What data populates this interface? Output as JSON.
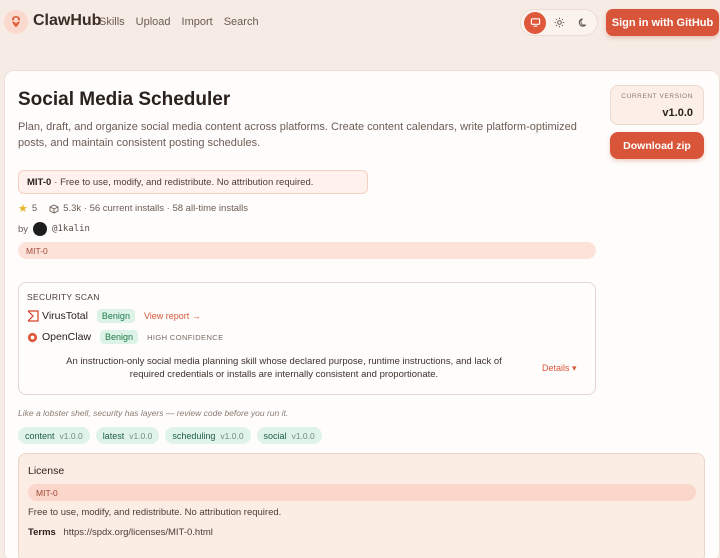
{
  "header": {
    "brand": "ClawHub",
    "nav": [
      "Skills",
      "Upload",
      "Import",
      "Search"
    ],
    "signin_label": "Sign in  with GitHub"
  },
  "skill": {
    "title": "Social Media Scheduler",
    "description": "Plan, draft, and organize social media content across platforms. Create content calendars, write platform-optimized posts, and maintain consistent posting schedules.",
    "license_chip_name": "MIT-0",
    "license_chip_text": "· Free to use, modify, and redistribute. No attribution required.",
    "stars": "5",
    "installs": "5.3k · 56 current installs · 58 all-time installs",
    "by_label": "by",
    "author_handle": "@1kalin",
    "license_tag": "MIT-0"
  },
  "scan": {
    "title": "SECURITY SCAN",
    "virustotal": {
      "name": "VirusTotal",
      "status": "Benign",
      "link": "View report →"
    },
    "openclaw": {
      "name": "OpenClaw",
      "status": "Benign",
      "confidence": "HIGH CONFIDENCE"
    },
    "summary": "An instruction-only social media planning skill whose declared purpose, runtime instructions, and lack of required credentials or installs are internally consistent and proportionate.",
    "details_label": "Details ▾"
  },
  "tagline": "Like a lobster shell, security has layers — review code before you run it.",
  "tags": [
    {
      "name": "content",
      "version": "v1.0.0"
    },
    {
      "name": "latest",
      "version": "v1.0.0"
    },
    {
      "name": "scheduling",
      "version": "v1.0.0"
    },
    {
      "name": "social",
      "version": "v1.0.0"
    }
  ],
  "license_panel": {
    "title": "License",
    "name": "MIT-0",
    "text": "Free to use, modify, and redistribute. No attribution required.",
    "terms_label": "Terms",
    "terms_url": "https://spdx.org/licenses/MIT-0.html"
  },
  "version": {
    "label": "CURRENT VERSION",
    "value": "v1.0.0",
    "download_label": "Download zip"
  },
  "colors": {
    "accent": "#d9553a",
    "benign_bg": "#def3e7",
    "benign_text": "#1f7a4b",
    "tag_bg": "#dff3ea"
  }
}
